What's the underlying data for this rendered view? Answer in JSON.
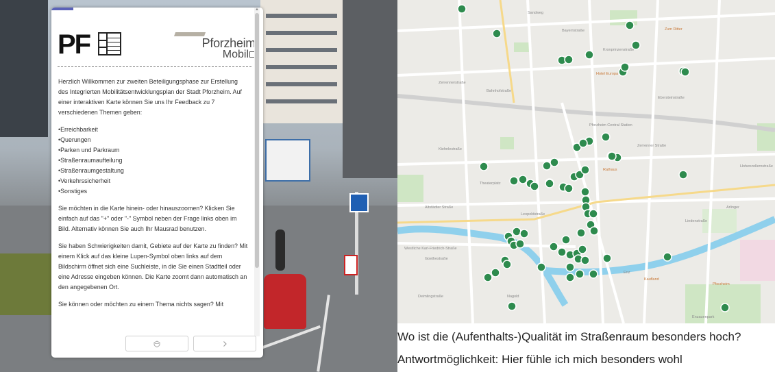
{
  "panel": {
    "logo_left": "PF",
    "logo_right_line1": "Pforzheim",
    "logo_right_line2": "Mobil",
    "intro": "Herzlich Willkommen zur zweiten Beteiligungsphase zur Erstellung des Integrierten Mobilitätsentwicklungsplan der Stadt Pforzheim. Auf einer interaktiven Karte können Sie uns Ihr Feedback zu 7 verschiedenen Themen geben:",
    "topics": [
      "Erreichbarkeit",
      "Querungen",
      "Parken und Parkraum",
      "Straßenraumaufteilung",
      "Straßenraumgestaltung",
      "Verkehrssicherheit",
      "Sonstiges"
    ],
    "zoom_help": "Sie möchten in die Karte hinein- oder hinauszoomen? Klicken Sie einfach auf das \"+\" oder \"-\" Symbol neben der Frage links oben im Bild. Alternativ können Sie auch Ihr Mausrad benutzen.",
    "search_help": "Sie haben Schwierigkeiten damit, Gebiete auf der Karte zu finden? Mit einem Klick auf das kleine Lupen-Symbol oben links auf dem Bildschirm öffnet sich eine Suchleiste, in die Sie einen Stadtteil oder eine Adresse eingeben können. Die Karte zoomt dann automatisch an den angegebenen Ort.",
    "skip_help": "Sie können oder möchten zu einem Thema nichts sagen? Mit",
    "prev_icon": "shield-icon",
    "next_icon": "chevron-right-icon",
    "progress_color": "#5b62b8"
  },
  "map": {
    "marker_color": "#2e8b4e",
    "street_labels": [
      "Sandweg",
      "Bayernstraße",
      "Zerrennerstraße",
      "Bahnhofstraße",
      "Pforzheim Central Station",
      "Kiehnlestraße",
      "Westliche Karl-Friedrich-Straße",
      "Leopoldstraße",
      "Enz",
      "Deimlingstraße",
      "Ebersteinstraße",
      "Nagold",
      "Altstädter Straße",
      "Pforzheim",
      "Rathaus",
      "Kaufland",
      "Zum Ritter",
      "Enzauenpark",
      "Hotel Europa",
      "Theaterplatz",
      "Zerrenner Straße",
      "Arlinger",
      "Kronprinzenstraße",
      "Lindenstraße",
      "Hohenzollernstraße",
      "Goethestraße"
    ]
  },
  "question": "Wo ist die (Aufenthalts-)Qualität im Straßenraum besonders hoch?",
  "answer": "Antwortmöglichkeit: Hier fühle ich mich besonders wohl"
}
